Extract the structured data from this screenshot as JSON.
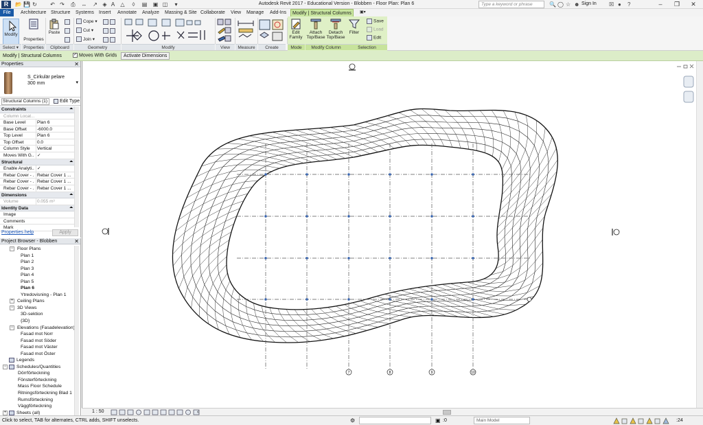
{
  "titlebar": {
    "logo": "R",
    "window_title": "Autodesk Revit 2017 - Educational Version -   Blobben - Floor Plan: Plan 6",
    "search_placeholder": "Type a keyword or phrase",
    "signin": "Sign In"
  },
  "tabs": {
    "file": "File",
    "items": [
      "Architecture",
      "Structure",
      "Systems",
      "Insert",
      "Annotate",
      "Analyze",
      "Massing & Site",
      "Collaborate",
      "View",
      "Manage",
      "Add-Ins",
      "Modify | Structural Columns"
    ]
  },
  "ribbon": {
    "modify": "Modify",
    "properties": "Properties",
    "paste": "Paste",
    "cope": "Cope",
    "cut": "Cut",
    "join": "Join",
    "edit_family_1": "Edit",
    "edit_family_2": "Family",
    "attach_1": "Attach",
    "attach_2": "Top/Base",
    "detach_1": "Detach",
    "detach_2": "Top/Base",
    "filter": "Filter",
    "save": "Save",
    "load": "Load",
    "edit": "Edit",
    "panels": {
      "select": "Select ▾",
      "properties": "Properties",
      "clipboard": "Clipboard",
      "geometry": "Geometry",
      "modify": "Modify",
      "view": "View",
      "measure": "Measure",
      "create": "Create",
      "mode": "Mode",
      "modify_column": "Modify Column",
      "selection": "Selection"
    }
  },
  "options_bar": {
    "context": "Modify | Structural Columns",
    "moves_with_grids": "Moves With Grids",
    "activate_dimensions": "Activate Dimensions"
  },
  "properties": {
    "header": "Properties",
    "type_name_1": "S_Cirkulär pelare",
    "type_name_2": "300 mm",
    "instance_filter": "Structural Columns (1)",
    "edit_type": "Edit Type",
    "groups": [
      {
        "name": "Constraints",
        "rows": [
          {
            "name": "Column Locat...",
            "value": "",
            "dim": true
          },
          {
            "name": "Base Level",
            "value": "Plan 6"
          },
          {
            "name": "Base Offset",
            "value": "-6000.0"
          },
          {
            "name": "Top Level",
            "value": "Plan 6"
          },
          {
            "name": "Top Offset",
            "value": "0.0"
          },
          {
            "name": "Column Style",
            "value": "Vertical"
          },
          {
            "name": "Moves With G...",
            "value": "✓"
          }
        ]
      },
      {
        "name": "Structural",
        "rows": [
          {
            "name": "Enable Analyti...",
            "value": "✓"
          },
          {
            "name": "Rebar Cover - ...",
            "value": "Rebar Cover 1 ..."
          },
          {
            "name": "Rebar Cover - ...",
            "value": "Rebar Cover 1 ..."
          },
          {
            "name": "Rebar Cover - ...",
            "value": "Rebar Cover 1 ..."
          }
        ]
      },
      {
        "name": "Dimensions",
        "rows": [
          {
            "name": "Volume",
            "value": "0.055 m³",
            "dim": true
          }
        ]
      },
      {
        "name": "Identity Data",
        "rows": [
          {
            "name": "Image",
            "value": ""
          },
          {
            "name": "Comments",
            "value": ""
          },
          {
            "name": "Mark",
            "value": ""
          }
        ]
      }
    ],
    "help": "Properties help",
    "apply": "Apply"
  },
  "browser": {
    "header": "Project Browser - Blobben",
    "items": [
      {
        "label": "Floor Plans",
        "level": 1,
        "toggle": "−"
      },
      {
        "label": "Plan 1",
        "level": 2
      },
      {
        "label": "Plan 2",
        "level": 2
      },
      {
        "label": "Plan 3",
        "level": 2
      },
      {
        "label": "Plan 4",
        "level": 2
      },
      {
        "label": "Plan 5",
        "level": 2
      },
      {
        "label": "Plan 6",
        "level": 2,
        "bold": true
      },
      {
        "label": "Ytredovisning - Plan 1",
        "level": 2
      },
      {
        "label": "Ceiling Plans",
        "level": 1,
        "toggle": "+"
      },
      {
        "label": "3D Views",
        "level": 1,
        "toggle": "−"
      },
      {
        "label": "3D-sektion",
        "level": 2
      },
      {
        "label": "{3D}",
        "level": 2
      },
      {
        "label": "Elevations (Fasadelevation)",
        "level": 1,
        "toggle": "−"
      },
      {
        "label": "Fasad mot Norr",
        "level": 2
      },
      {
        "label": "Fasad mot Söder",
        "level": 2
      },
      {
        "label": "Fasad mot Väster",
        "level": 2
      },
      {
        "label": "Fasad mot Öster",
        "level": 2
      },
      {
        "label": "Legends",
        "level": 0,
        "icon": true
      },
      {
        "label": "Schedules/Quantities",
        "level": 0,
        "icon": true,
        "toggle": "−"
      },
      {
        "label": "Dörrförteckning",
        "level": 1
      },
      {
        "label": "Fönsterförteckning",
        "level": 1
      },
      {
        "label": "Mass Floor Schedule",
        "level": 1
      },
      {
        "label": "Ritningsförteckning Blad 1",
        "level": 1
      },
      {
        "label": "Rumsförteckning",
        "level": 1
      },
      {
        "label": "Väggförteckning",
        "level": 1
      },
      {
        "label": "Sheets (all)",
        "level": 0,
        "icon": true,
        "toggle": "+"
      }
    ]
  },
  "view": {
    "scale": "1 : 50",
    "grid_labels": [
      "7",
      "8",
      "9",
      "10"
    ]
  },
  "status": {
    "text": "Click to select, TAB for alternates, CTRL adds, SHIFT unselects.",
    "zero": ":0",
    "model": "Main Model",
    "count": ":24"
  },
  "colors": {
    "context_tab": "#c9e6a0",
    "options_bar": "#dcedc8",
    "file_tab": "#1a5aa6",
    "grid_line": "#555555",
    "grid_dot": "#3a66b0"
  }
}
